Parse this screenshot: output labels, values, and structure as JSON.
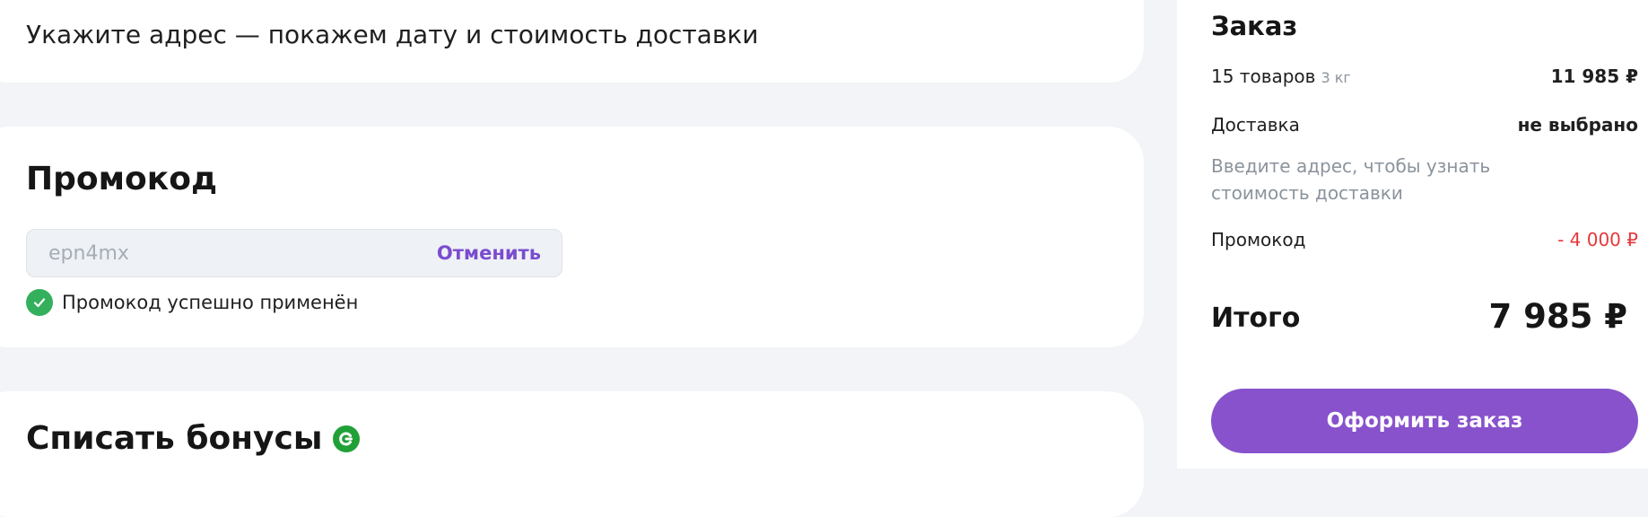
{
  "address": {
    "prompt": "Укажите адрес — покажем дату и стоимость доставки"
  },
  "promo": {
    "title": "Промокод",
    "code": "epn4mx",
    "cancel_label": "Отменить",
    "status": "Промокод успешно применён",
    "status_color": "#34b05c"
  },
  "bonus": {
    "title": "Списать бонусы",
    "icon": "bonus-coin-icon",
    "icon_color": "#21a038"
  },
  "summary": {
    "title": "Заказ",
    "items_label": "15 товаров",
    "items_weight": "3 кг",
    "items_value": "11 985 ₽",
    "delivery_label": "Доставка",
    "delivery_value": "не выбрано",
    "delivery_hint": "Введите адрес, чтобы узнать стоимость доставки",
    "promo_label": "Промокод",
    "promo_value": "- 4 000 ₽",
    "total_label": "Итого",
    "total_value": "7 985 ₽",
    "checkout_label": "Оформить заказ"
  },
  "colors": {
    "accent": "#8852cc",
    "link": "#7a4ccf",
    "discount": "#e5383b",
    "background": "#f2f4f7"
  }
}
